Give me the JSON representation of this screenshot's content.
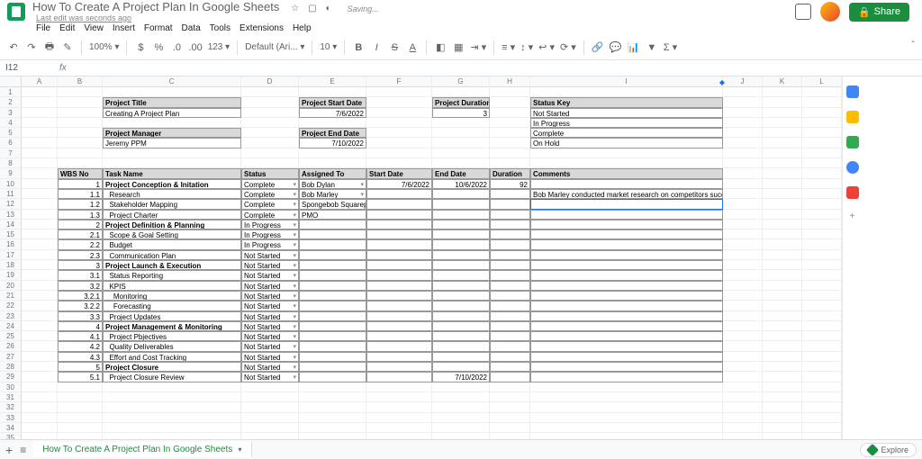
{
  "header": {
    "doc_title": "How To Create A Project Plan In Google Sheets",
    "saving": "Saving...",
    "last_edit": "Last edit was seconds ago",
    "share": "Share"
  },
  "menu": [
    "File",
    "Edit",
    "View",
    "Insert",
    "Format",
    "Data",
    "Tools",
    "Extensions",
    "Help"
  ],
  "toolbar": {
    "zoom": "100%",
    "currency": "$",
    "percent": "%",
    "dec_dec": ".0",
    "dec_inc": ".00",
    "more_fmt": "123",
    "font": "Default (Ari...",
    "size": "10"
  },
  "name_box": "I12",
  "columns": [
    "A",
    "B",
    "C",
    "D",
    "E",
    "F",
    "G",
    "H",
    "I",
    "J",
    "K",
    "L"
  ],
  "meta": {
    "project_title_label": "Project Title",
    "project_title_value": "Creating A Project Plan",
    "project_manager_label": "Project Manager",
    "project_manager_value": "Jeremy PPM",
    "project_start_label": "Project Start Date",
    "project_start_value": "7/6/2022",
    "project_end_label": "Project End Date",
    "project_end_value": "7/10/2022",
    "project_duration_label": "Project Duration",
    "project_duration_value": "3",
    "status_key_label": "Status Key",
    "status_keys": [
      "Not Started",
      "In Progress",
      "Complete",
      "On Hold"
    ]
  },
  "table_headers": {
    "wbs": "WBS No",
    "task": "Task Name",
    "status": "Status",
    "assigned": "Assigned To",
    "start": "Start Date",
    "end": "End Date",
    "duration": "Duration",
    "comments": "Comments"
  },
  "rows": [
    {
      "wbs": "1",
      "task": "Project Conception & Initation",
      "indent": 0,
      "bold": true,
      "status": "Complete",
      "assigned": "Bob Dylan",
      "start": "7/6/2022",
      "end": "10/6/2022",
      "duration": "92",
      "comments": ""
    },
    {
      "wbs": "1.1",
      "task": "Research",
      "indent": 1,
      "status": "Complete",
      "assigned": "Bob Marley",
      "start": "",
      "end": "",
      "duration": "",
      "comments": "Bob Marley conducted market research on competitors successfully"
    },
    {
      "wbs": "1.2",
      "task": "Stakeholder Mapping",
      "indent": 1,
      "status": "Complete",
      "assigned": "Spongebob Squarepants",
      "start": "",
      "end": "",
      "duration": "",
      "comments": ""
    },
    {
      "wbs": "1.3",
      "task": "Project Charter",
      "indent": 1,
      "status": "Complete",
      "assigned": "PMO",
      "start": "",
      "end": "",
      "duration": "",
      "comments": ""
    },
    {
      "wbs": "2",
      "task": "Project Definition & Planning",
      "indent": 0,
      "bold": true,
      "status": "In Progress",
      "assigned": "",
      "start": "",
      "end": "",
      "duration": "",
      "comments": ""
    },
    {
      "wbs": "2.1",
      "task": "Scope & Goal Setting",
      "indent": 1,
      "status": "In Progress",
      "assigned": "",
      "start": "",
      "end": "",
      "duration": "",
      "comments": ""
    },
    {
      "wbs": "2.2",
      "task": "Budget",
      "indent": 1,
      "status": "In Progress",
      "assigned": "",
      "start": "",
      "end": "",
      "duration": "",
      "comments": ""
    },
    {
      "wbs": "2.3",
      "task": "Communication Plan",
      "indent": 1,
      "status": "Not Started",
      "assigned": "",
      "start": "",
      "end": "",
      "duration": "",
      "comments": ""
    },
    {
      "wbs": "3",
      "task": "Project Launch & Execution",
      "indent": 0,
      "bold": true,
      "status": "Not Started",
      "assigned": "",
      "start": "",
      "end": "",
      "duration": "",
      "comments": ""
    },
    {
      "wbs": "3.1",
      "task": "Status Reporting",
      "indent": 1,
      "status": "Not Started",
      "assigned": "",
      "start": "",
      "end": "",
      "duration": "",
      "comments": ""
    },
    {
      "wbs": "3.2",
      "task": "KPIS",
      "indent": 1,
      "status": "Not Started",
      "assigned": "",
      "start": "",
      "end": "",
      "duration": "",
      "comments": ""
    },
    {
      "wbs": "3.2.1",
      "task": "Monitoring",
      "indent": 2,
      "status": "Not Started",
      "assigned": "",
      "start": "",
      "end": "",
      "duration": "",
      "comments": ""
    },
    {
      "wbs": "3.2.2",
      "task": "Forecasting",
      "indent": 2,
      "status": "Not Started",
      "assigned": "",
      "start": "",
      "end": "",
      "duration": "",
      "comments": ""
    },
    {
      "wbs": "3.3",
      "task": "Project Updates",
      "indent": 1,
      "status": "Not Started",
      "assigned": "",
      "start": "",
      "end": "",
      "duration": "",
      "comments": ""
    },
    {
      "wbs": "4",
      "task": "Project Management & Monitoring",
      "indent": 0,
      "bold": true,
      "status": "Not Started",
      "assigned": "",
      "start": "",
      "end": "",
      "duration": "",
      "comments": ""
    },
    {
      "wbs": "4.1",
      "task": "Project Pbjectives",
      "indent": 1,
      "status": "Not Started",
      "assigned": "",
      "start": "",
      "end": "",
      "duration": "",
      "comments": ""
    },
    {
      "wbs": "4.2",
      "task": "Quality Deliverables",
      "indent": 1,
      "status": "Not Started",
      "assigned": "",
      "start": "",
      "end": "",
      "duration": "",
      "comments": ""
    },
    {
      "wbs": "4.3",
      "task": "Effort and Cost Tracking",
      "indent": 1,
      "status": "Not Started",
      "assigned": "",
      "start": "",
      "end": "",
      "duration": "",
      "comments": ""
    },
    {
      "wbs": "5",
      "task": "Project Closure",
      "indent": 0,
      "bold": true,
      "status": "Not Started",
      "assigned": "",
      "start": "",
      "end": "",
      "duration": "",
      "comments": ""
    },
    {
      "wbs": "5.1",
      "task": "Project Closure Review",
      "indent": 1,
      "status": "Not Started",
      "assigned": "",
      "start": "",
      "end": "7/10/2022",
      "duration": "",
      "comments": ""
    }
  ],
  "tab_name": "How To Create A Project Plan In Google Sheets",
  "explore": "Explore"
}
